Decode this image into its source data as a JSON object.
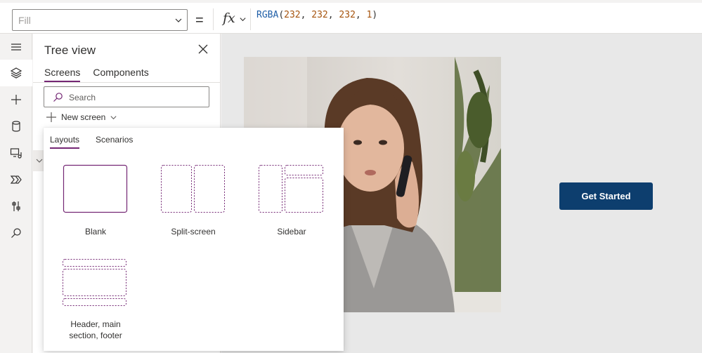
{
  "formula_bar": {
    "property": "Fill",
    "equals": "=",
    "fx_label": "fx",
    "formula": {
      "fn": "RGBA",
      "open": "(",
      "args": [
        "232",
        "232",
        "232",
        "1"
      ],
      "sep": ", ",
      "close": ")"
    }
  },
  "rail": {
    "items": [
      {
        "name": "menu-icon"
      },
      {
        "name": "layers-icon",
        "active": true
      },
      {
        "name": "plus-icon"
      },
      {
        "name": "database-icon"
      },
      {
        "name": "media-icon"
      },
      {
        "name": "power-automate-icon"
      },
      {
        "name": "tools-icon"
      },
      {
        "name": "search-icon"
      }
    ]
  },
  "tree_view": {
    "title": "Tree view",
    "tabs": [
      {
        "label": "Screens",
        "active": true
      },
      {
        "label": "Components",
        "active": false
      }
    ],
    "search_placeholder": "Search",
    "new_screen_label": "New screen"
  },
  "popup": {
    "tabs": [
      {
        "label": "Layouts",
        "active": true
      },
      {
        "label": "Scenarios",
        "active": false
      }
    ],
    "layouts": [
      {
        "label": "Blank"
      },
      {
        "label": "Split-screen"
      },
      {
        "label": "Sidebar"
      },
      {
        "label": "Header, main section, footer"
      }
    ]
  },
  "canvas": {
    "button_label": "Get Started"
  },
  "colors": {
    "accent": "#742774",
    "button": "#0d3e6e",
    "canvas_fill": "#e8e8e8"
  }
}
